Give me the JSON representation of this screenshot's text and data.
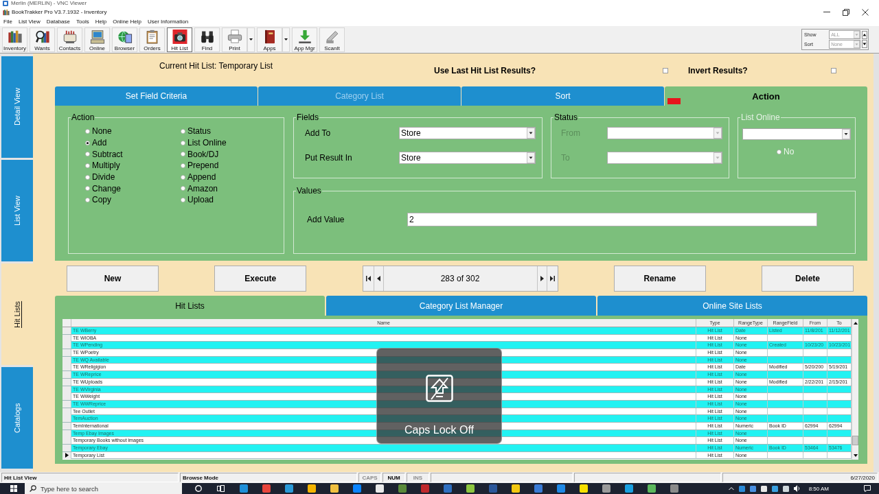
{
  "vnc_window": {
    "title": "Merlin (MERLIN) - VNC Viewer"
  },
  "window": {
    "title": "BookTrakker Pro V3.7.1932 - Inventory"
  },
  "menu": [
    "File",
    "List View",
    "Database",
    "Tools",
    "Help",
    "Online Help",
    "User Information"
  ],
  "toolbar": [
    {
      "label": "Inventory",
      "selected": false,
      "dropdown": false
    },
    {
      "label": "Wants",
      "selected": false,
      "dropdown": false
    },
    {
      "label": "Contacts",
      "selected": false,
      "dropdown": false
    },
    {
      "label": "Online",
      "selected": false,
      "dropdown": false
    },
    {
      "label": "Browser",
      "selected": false,
      "dropdown": false
    },
    {
      "label": "Orders",
      "selected": false,
      "dropdown": false
    },
    {
      "label": "Hit List",
      "selected": true,
      "dropdown": false
    },
    {
      "label": "Find",
      "selected": false,
      "dropdown": false
    },
    {
      "label": "Print",
      "selected": false,
      "dropdown": true
    },
    {
      "label": "Apps",
      "selected": false,
      "dropdown": true
    },
    {
      "label": "App Mgr",
      "selected": false,
      "dropdown": false
    },
    {
      "label": "ScanIt",
      "selected": false,
      "dropdown": false
    }
  ],
  "view_filter": {
    "show": {
      "label": "Show",
      "value": "ALL"
    },
    "sort": {
      "label": "Sort",
      "value": "None"
    }
  },
  "sidebar": [
    {
      "label": "Detail View",
      "selected": false
    },
    {
      "label": "List View",
      "selected": false
    },
    {
      "label": "Hit Lists",
      "selected": true
    },
    {
      "label": "Catalogs",
      "selected": false
    }
  ],
  "header": {
    "current_list": "Current Hit List: Temporary List",
    "use_last_results": {
      "label": "Use Last Hit List Results?",
      "checked": false
    },
    "invert_results": {
      "label": "Invert Results?",
      "checked": false
    }
  },
  "criteria_tabs": [
    {
      "label": "Set Field Criteria",
      "selected": false,
      "disabled": false,
      "flagged": false
    },
    {
      "label": "Category List",
      "selected": false,
      "disabled": true,
      "flagged": false
    },
    {
      "label": "Sort",
      "selected": false,
      "disabled": false,
      "flagged": false
    },
    {
      "label": "Action",
      "selected": true,
      "disabled": false,
      "flagged": true
    }
  ],
  "action_panel": {
    "action_group": {
      "title": "Action",
      "options": [
        {
          "label": "None",
          "selected": false
        },
        {
          "label": "Add",
          "selected": true
        },
        {
          "label": "Subtract",
          "selected": false
        },
        {
          "label": "Multiply",
          "selected": false
        },
        {
          "label": "Divide",
          "selected": false
        },
        {
          "label": "Change",
          "selected": false
        },
        {
          "label": "Copy",
          "selected": false
        },
        {
          "label": "Status",
          "selected": false
        },
        {
          "label": "List Online",
          "selected": false
        },
        {
          "label": "Book/DJ",
          "selected": false
        },
        {
          "label": "Prepend",
          "selected": false
        },
        {
          "label": "Append",
          "selected": false
        },
        {
          "label": "Amazon",
          "selected": false
        },
        {
          "label": "Upload",
          "selected": false
        }
      ]
    },
    "fields_group": {
      "title": "Fields",
      "rows": [
        {
          "label": "Add To",
          "value": "Store"
        },
        {
          "label": "Put Result In",
          "value": "Store"
        }
      ]
    },
    "status_group": {
      "title": "Status",
      "rows": [
        {
          "label": "From",
          "disabled": true
        },
        {
          "label": "To",
          "disabled": true
        }
      ]
    },
    "list_online_group": {
      "title": "List Online",
      "disabled": true,
      "options": [
        {
          "label": "No",
          "selected": false
        }
      ]
    },
    "values_group": {
      "title": "Values",
      "label": "Add Value",
      "value": "2"
    }
  },
  "commands": [
    {
      "kind": "button",
      "label": "New"
    },
    {
      "kind": "button",
      "label": "Execute"
    },
    {
      "kind": "navigator",
      "label": "283 of 302"
    },
    {
      "kind": "button",
      "label": "Rename"
    },
    {
      "kind": "button",
      "label": "Delete"
    }
  ],
  "list_tabs": [
    {
      "label": "Hit Lists",
      "selected": true
    },
    {
      "label": "Category List Manager",
      "selected": false
    },
    {
      "label": "Online Site Lists",
      "selected": false
    }
  ],
  "table": {
    "columns": [
      "Name",
      "Type",
      "RangeType",
      "RangeField",
      "From",
      "To"
    ],
    "rows": [
      {
        "name": "TE WBerry",
        "type": "Hit List",
        "range_type": "Date",
        "range_field": "Listed",
        "from": "11/8/201",
        "to": "11/12/201",
        "selected": false
      },
      {
        "name": "TE WIOBA",
        "type": "Hit List",
        "range_type": "None",
        "selected": false
      },
      {
        "name": "TE WPending",
        "type": "Hit List",
        "range_type": "None",
        "range_field": "Created",
        "from": "10/23/20",
        "to": "10/23/201",
        "selected": false
      },
      {
        "name": "TE WPoetry",
        "type": "Hit List",
        "range_type": "None",
        "selected": false
      },
      {
        "name": "TE WQ Available",
        "type": "Hit List",
        "range_type": "None",
        "selected": false
      },
      {
        "name": "TE WReligigion",
        "type": "Hit List",
        "range_type": "Date",
        "range_field": "Modified",
        "from": "5/20/200",
        "to": "5/19/201",
        "selected": false
      },
      {
        "name": "TE WReprice",
        "type": "Hit List",
        "range_type": "None",
        "selected": false
      },
      {
        "name": "TE WUploads",
        "type": "Hit List",
        "range_type": "None",
        "range_field": "Modified",
        "from": "2/22/201",
        "to": "2/15/201",
        "selected": false
      },
      {
        "name": "TE WVirginia",
        "type": "Hit List",
        "range_type": "None",
        "selected": false
      },
      {
        "name": "TE WWeight",
        "type": "Hit List",
        "range_type": "None",
        "selected": false
      },
      {
        "name": "TE WWReprice",
        "type": "Hit List",
        "range_type": "None",
        "selected": false
      },
      {
        "name": "Tee Outlet",
        "type": "Hit List",
        "range_type": "None",
        "selected": false
      },
      {
        "name": "TemAuction",
        "type": "Hit List",
        "range_type": "None",
        "selected": false
      },
      {
        "name": "TemInternational",
        "type": "Hit List",
        "range_type": "Numeric",
        "range_field": "Book ID",
        "from": "62994",
        "to": "62994",
        "selected": false
      },
      {
        "name": "Temp Ebay Images",
        "type": "Hit List",
        "range_type": "None",
        "selected": false
      },
      {
        "name": "Temporary Books without images",
        "type": "Hit List",
        "range_type": "None",
        "selected": false
      },
      {
        "name": "Temporary Ebay",
        "type": "Hit List",
        "range_type": "Numeric",
        "range_field": "Book ID",
        "from": "53464",
        "to": "53476",
        "selected": false
      },
      {
        "name": "Temporary List",
        "type": "Hit List",
        "range_type": "None",
        "selected": true
      }
    ]
  },
  "caps_lock_popup": {
    "text": "Caps Lock Off"
  },
  "status_bar": {
    "panes": [
      "Hit List View",
      "Browse Mode"
    ],
    "keys": [
      {
        "label": "CAPS",
        "on": false
      },
      {
        "label": "NUM",
        "on": true
      },
      {
        "label": "INS",
        "on": false
      }
    ],
    "date": "6/27/2020"
  },
  "taskbar": {
    "search": {
      "placeholder": "Type here to search"
    },
    "time": "8:50 AM"
  }
}
